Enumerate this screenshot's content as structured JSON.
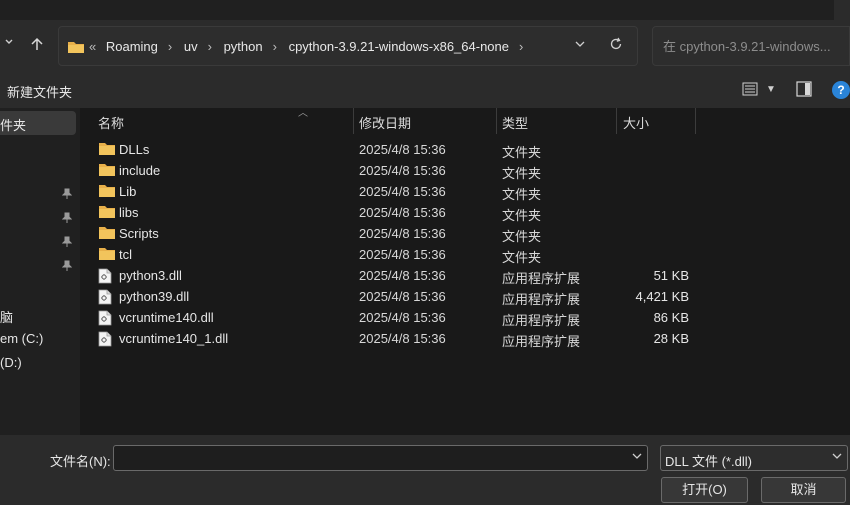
{
  "address": {
    "overflow": "«",
    "crumbs": [
      "Roaming",
      "uv",
      "python",
      "cpython-3.9.21-windows-x86_64-none"
    ],
    "dropdown_icon": "chevron-down-icon",
    "refresh_icon": "refresh-icon"
  },
  "search": {
    "placeholder": "在 cpython-3.9.21-windows..."
  },
  "toolbar": {
    "new_folder": "新建文件夹"
  },
  "nav": {
    "items": [
      "件夹",
      "脑",
      "em (C:)",
      "(D:)"
    ]
  },
  "columns": {
    "name": "名称",
    "date": "修改日期",
    "type": "类型",
    "size": "大小"
  },
  "files": [
    {
      "name": "DLLs",
      "date": "2025/4/8 15:36",
      "type": "文件夹",
      "size": "",
      "icon": "folder-icon"
    },
    {
      "name": "include",
      "date": "2025/4/8 15:36",
      "type": "文件夹",
      "size": "",
      "icon": "folder-icon"
    },
    {
      "name": "Lib",
      "date": "2025/4/8 15:36",
      "type": "文件夹",
      "size": "",
      "icon": "folder-icon"
    },
    {
      "name": "libs",
      "date": "2025/4/8 15:36",
      "type": "文件夹",
      "size": "",
      "icon": "folder-icon"
    },
    {
      "name": "Scripts",
      "date": "2025/4/8 15:36",
      "type": "文件夹",
      "size": "",
      "icon": "folder-icon"
    },
    {
      "name": "tcl",
      "date": "2025/4/8 15:36",
      "type": "文件夹",
      "size": "",
      "icon": "folder-icon"
    },
    {
      "name": "python3.dll",
      "date": "2025/4/8 15:36",
      "type": "应用程序扩展",
      "size": "51 KB",
      "icon": "dll-file-icon"
    },
    {
      "name": "python39.dll",
      "date": "2025/4/8 15:36",
      "type": "应用程序扩展",
      "size": "4,421 KB",
      "icon": "dll-file-icon"
    },
    {
      "name": "vcruntime140.dll",
      "date": "2025/4/8 15:36",
      "type": "应用程序扩展",
      "size": "86 KB",
      "icon": "dll-file-icon"
    },
    {
      "name": "vcruntime140_1.dll",
      "date": "2025/4/8 15:36",
      "type": "应用程序扩展",
      "size": "28 KB",
      "icon": "dll-file-icon"
    }
  ],
  "bottom": {
    "filename_label": "文件名(N):",
    "filename_value": "",
    "filter_value": "DLL 文件 (*.dll)",
    "open_label": "打开(O)",
    "cancel_label": "取消"
  },
  "colors": {
    "folder": "#e8b04a",
    "accent": "#2a84d8"
  }
}
